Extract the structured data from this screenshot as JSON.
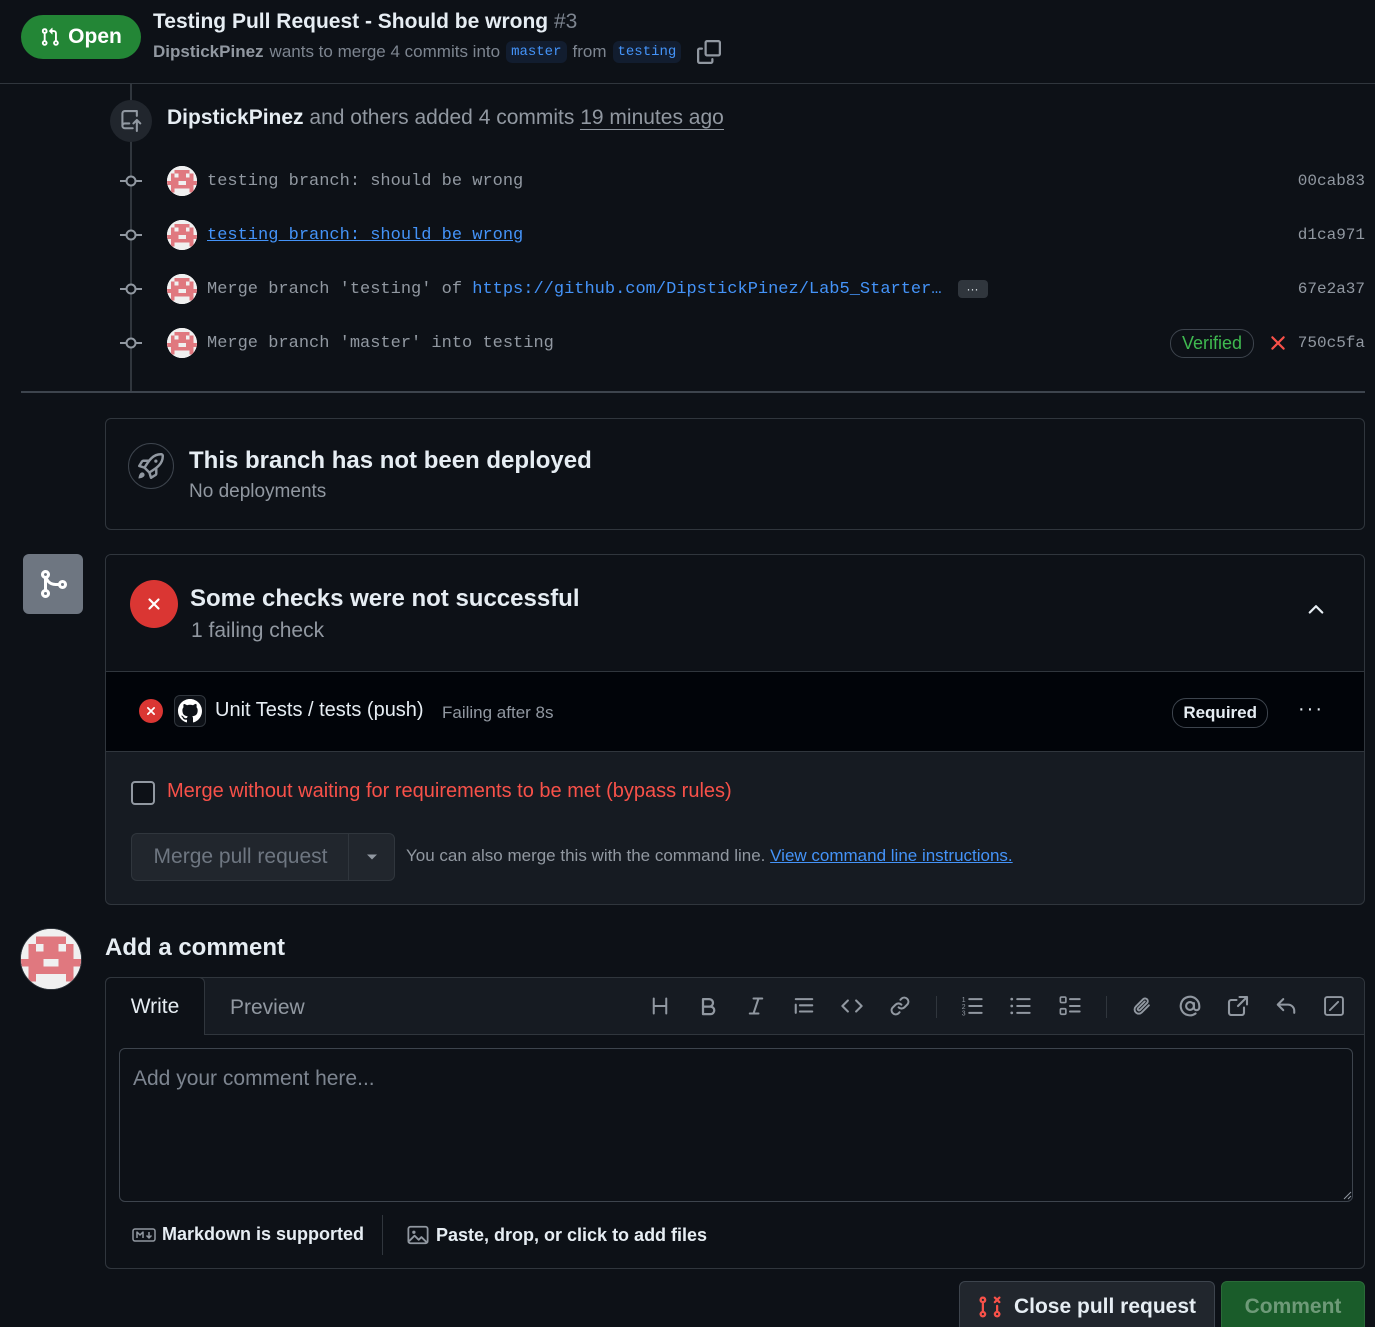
{
  "header": {
    "state": "Open",
    "title": "Testing Pull Request - Should be wrong",
    "number": "#3",
    "author": "DipstickPinez",
    "merge_text": "wants to merge 4 commits into",
    "base_branch": "master",
    "from_text": "from",
    "head_branch": "testing"
  },
  "timeline": {
    "who": "DipstickPinez",
    "action": "and others added 4 commits",
    "ago": "19 minutes ago",
    "commits": [
      {
        "message": "testing branch: should be wrong",
        "sha": "00cab83"
      },
      {
        "message": "testing branch: should be wrong",
        "sha": "d1ca971"
      },
      {
        "message_prefix": "Merge branch 'testing' of",
        "url": "https://github.com/DipstickPinez/Lab5_Starter…",
        "more": "···",
        "sha": "67e2a37"
      },
      {
        "message": "Merge branch 'master' into testing",
        "verified": "Verified",
        "sha": "750c5fa"
      }
    ]
  },
  "deploy": {
    "title": "This branch has not been deployed",
    "subtitle": "No deployments"
  },
  "checks": {
    "title": "Some checks were not successful",
    "subtitle": "1 failing check",
    "item": {
      "name": "Unit Tests / tests (push)",
      "status": "Failing after 8s",
      "badge": "Required",
      "more": "···"
    },
    "bypass_label": "Merge without waiting for requirements to be met (bypass rules)",
    "merge_button": "Merge pull request",
    "cli_text": "You can also merge this with the command line.",
    "cli_link": "View command line instructions."
  },
  "comment": {
    "title": "Add a comment",
    "tab_write": "Write",
    "tab_preview": "Preview",
    "placeholder": "Add your comment here...",
    "markdown_note": "Markdown is supported",
    "files_note": "Paste, drop, or click to add files",
    "close_button": "Close pull request",
    "comment_button": "Comment"
  },
  "colors": {
    "open_green": "#238636",
    "fail_red": "#da3633",
    "link_blue": "#4493f8",
    "verified_green": "#3fb950"
  }
}
